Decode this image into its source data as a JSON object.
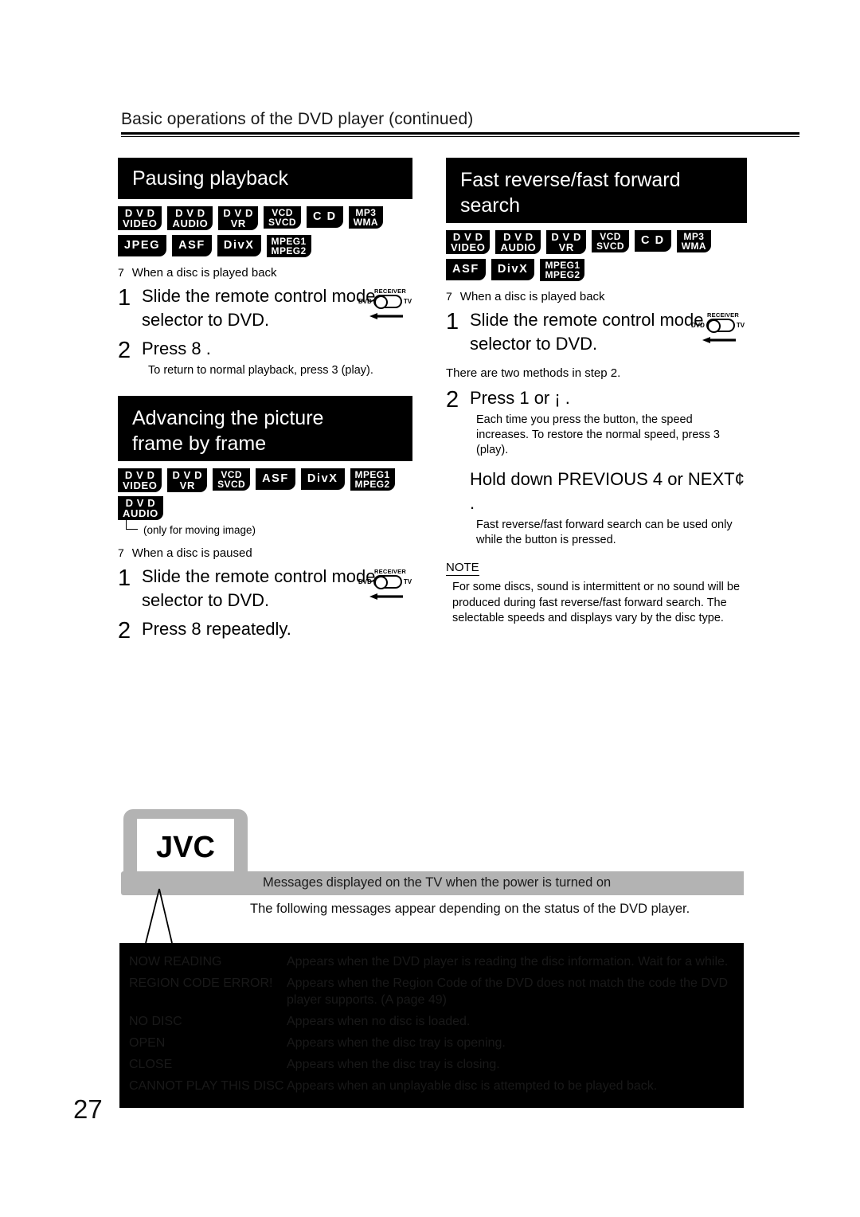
{
  "header": {
    "title": "Basic operations of the DVD player (continued)"
  },
  "page_number": "27",
  "sections": {
    "pausing": {
      "heading": "Pausing playback",
      "badges": [
        {
          "l1": "D V D",
          "l2": "VIDEO",
          "kind": "dual"
        },
        {
          "l1": "D V D",
          "l2": "AUDIO",
          "kind": "dual"
        },
        {
          "l1": "D V D",
          "l2": "VR",
          "kind": "dual"
        },
        {
          "l1": "VCD",
          "l2": "SVCD",
          "kind": "stack"
        },
        {
          "l1": "C D",
          "l2": "",
          "kind": "single"
        },
        {
          "l1": "MP3",
          "l2": "WMA",
          "kind": "stack"
        },
        {
          "l1": "JPEG",
          "l2": "",
          "kind": "single"
        },
        {
          "l1": "ASF",
          "l2": "",
          "kind": "single"
        },
        {
          "l1": "DivX",
          "l2": "",
          "kind": "single"
        },
        {
          "l1": "MPEG1",
          "l2": "MPEG2",
          "kind": "stack"
        }
      ],
      "precondition_mark": "7",
      "precondition": "When a disc is played back",
      "step1_num": "1",
      "step1_text": "Slide the remote control mode selector to DVD.",
      "step2_num": "2",
      "step2_text": "Press 8 .",
      "step2_sub": "To return to normal playback, press 3 (play)."
    },
    "advancing": {
      "heading_line1": "Advancing the picture",
      "heading_line2": "frame by frame",
      "badges": [
        {
          "l1": "D V D",
          "l2": "VIDEO",
          "kind": "dual"
        },
        {
          "l1": "D V D",
          "l2": "VR",
          "kind": "dual"
        },
        {
          "l1": "VCD",
          "l2": "SVCD",
          "kind": "stack"
        },
        {
          "l1": "ASF",
          "l2": "",
          "kind": "single"
        },
        {
          "l1": "DivX",
          "l2": "",
          "kind": "single"
        },
        {
          "l1": "MPEG1",
          "l2": "MPEG2",
          "kind": "stack"
        }
      ],
      "badge_note_badge": {
        "l1": "D V D",
        "l2": "AUDIO",
        "kind": "dual"
      },
      "badge_note": "(only for moving image)",
      "precondition_mark": "7",
      "precondition": "When a disc is paused",
      "step1_num": "1",
      "step1_text": "Slide the remote control mode selector to DVD.",
      "step2_num": "2",
      "step2_text": "Press 8 repeatedly."
    },
    "fast_search": {
      "heading_line1": "Fast reverse/fast forward",
      "heading_line2": "search",
      "badges": [
        {
          "l1": "D V D",
          "l2": "VIDEO",
          "kind": "dual"
        },
        {
          "l1": "D V D",
          "l2": "AUDIO",
          "kind": "dual"
        },
        {
          "l1": "D V D",
          "l2": "VR",
          "kind": "dual"
        },
        {
          "l1": "VCD",
          "l2": "SVCD",
          "kind": "stack"
        },
        {
          "l1": "C D",
          "l2": "",
          "kind": "single"
        },
        {
          "l1": "MP3",
          "l2": "WMA",
          "kind": "stack"
        },
        {
          "l1": "ASF",
          "l2": "",
          "kind": "single"
        },
        {
          "l1": "DivX",
          "l2": "",
          "kind": "single"
        },
        {
          "l1": "MPEG1",
          "l2": "MPEG2",
          "kind": "stack"
        }
      ],
      "precondition_mark": "7",
      "precondition": "When a disc is played back",
      "step1_num": "1",
      "step1_text": "Slide the remote control mode selector to DVD.",
      "two_methods": "There are two methods in step 2.",
      "step2_num": "2",
      "step2_text": "Press 1 or ¡ .",
      "step2_sub": "Each time you press the button, the speed increases. To restore the normal speed, press 3 (play).",
      "hold_text": "Hold down PREVIOUS 4 or NEXT¢ .",
      "hold_sub": "Fast reverse/fast forward search can be used only while the button is pressed.",
      "note_label": "NOTE",
      "note_text": "For some discs, sound is intermittent or no sound will be produced during fast reverse/fast forward search. The selectable speeds and displays vary by the disc type."
    }
  },
  "remote_selector": {
    "receiver_label": "RECEIVER",
    "left_label": "DVD",
    "right_label": "TV"
  },
  "tv_illustration": {
    "logo": "JVC"
  },
  "messages": {
    "bar_title": "Messages displayed on the TV when the power is turned on",
    "intro": "The following messages appear depending on the status of the DVD player.",
    "rows": [
      {
        "code": "NOW READING",
        "desc": "Appears when the DVD player is reading the disc information. Wait for a while."
      },
      {
        "code": "REGION CODE ERROR!",
        "desc": "Appears when the Region Code of the DVD does not match the code the DVD player supports. (A  page 49)"
      },
      {
        "code": "NO DISC",
        "desc": "Appears when no disc is loaded."
      },
      {
        "code": "OPEN",
        "desc": "Appears when the disc tray is opening."
      },
      {
        "code": "CLOSE",
        "desc": "Appears when the disc tray is closing."
      },
      {
        "code": "CANNOT PLAY THIS DISC",
        "desc": "Appears when an unplayable disc is attempted to be played back."
      }
    ]
  },
  "colors": {
    "banner_bg": "#000000",
    "bar_bg": "#b3b3b3",
    "table_bg": "#000000",
    "table_text": "#191919",
    "tv_body": "#b3b3b3"
  }
}
